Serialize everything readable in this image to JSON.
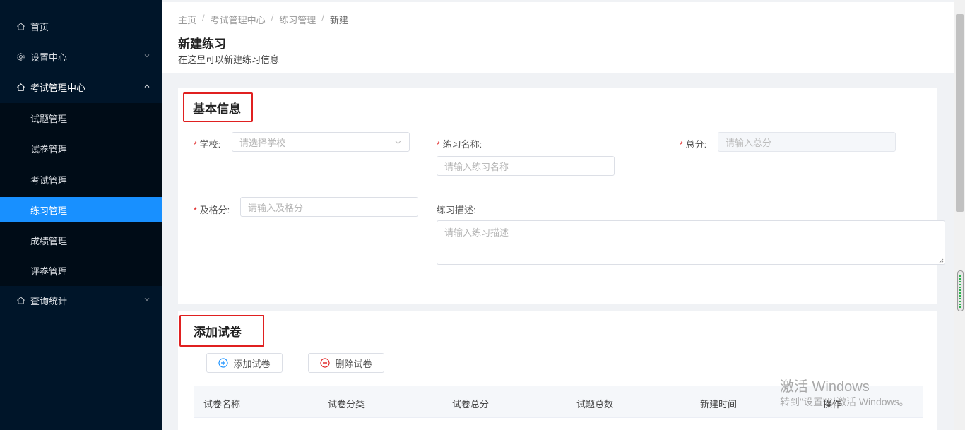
{
  "sidebar": {
    "items": [
      {
        "label": "首页",
        "icon": "home-icon"
      },
      {
        "label": "设置中心",
        "icon": "gear-icon"
      },
      {
        "label": "考试管理中心",
        "icon": "home-icon"
      },
      {
        "label": "查询统计",
        "icon": "home-icon"
      }
    ],
    "submenu": [
      {
        "label": "试题管理"
      },
      {
        "label": "试卷管理"
      },
      {
        "label": "考试管理"
      },
      {
        "label": "练习管理",
        "active": true
      },
      {
        "label": "成绩管理"
      },
      {
        "label": "评卷管理"
      }
    ]
  },
  "header": {
    "breadcrumb": [
      "主页",
      "考试管理中心",
      "练习管理",
      "新建"
    ],
    "title": "新建练习",
    "subtitle": "在这里可以新建练习信息"
  },
  "basic": {
    "section_title": "基本信息",
    "school_label": "学校:",
    "school_placeholder": "请选择学校",
    "name_label": "练习名称:",
    "name_placeholder": "请输入练习名称",
    "total_label": "总分:",
    "total_placeholder": "请输入总分",
    "pass_label": "及格分:",
    "pass_placeholder": "请输入及格分",
    "desc_label": "练习描述:",
    "desc_placeholder": "请输入练习描述"
  },
  "papers": {
    "section_title": "添加试卷",
    "add_button": "添加试卷",
    "delete_button": "删除试卷",
    "columns": [
      "试卷名称",
      "试卷分类",
      "试卷总分",
      "试题总数",
      "新建时间",
      "操作"
    ]
  },
  "watermark": {
    "line1": "激活 Windows",
    "line2": "转到\"设置\"以激活 Windows。"
  },
  "colors": {
    "sidebar_bg": "#001529",
    "active_item": "#1890ff",
    "required": "#e02020"
  }
}
